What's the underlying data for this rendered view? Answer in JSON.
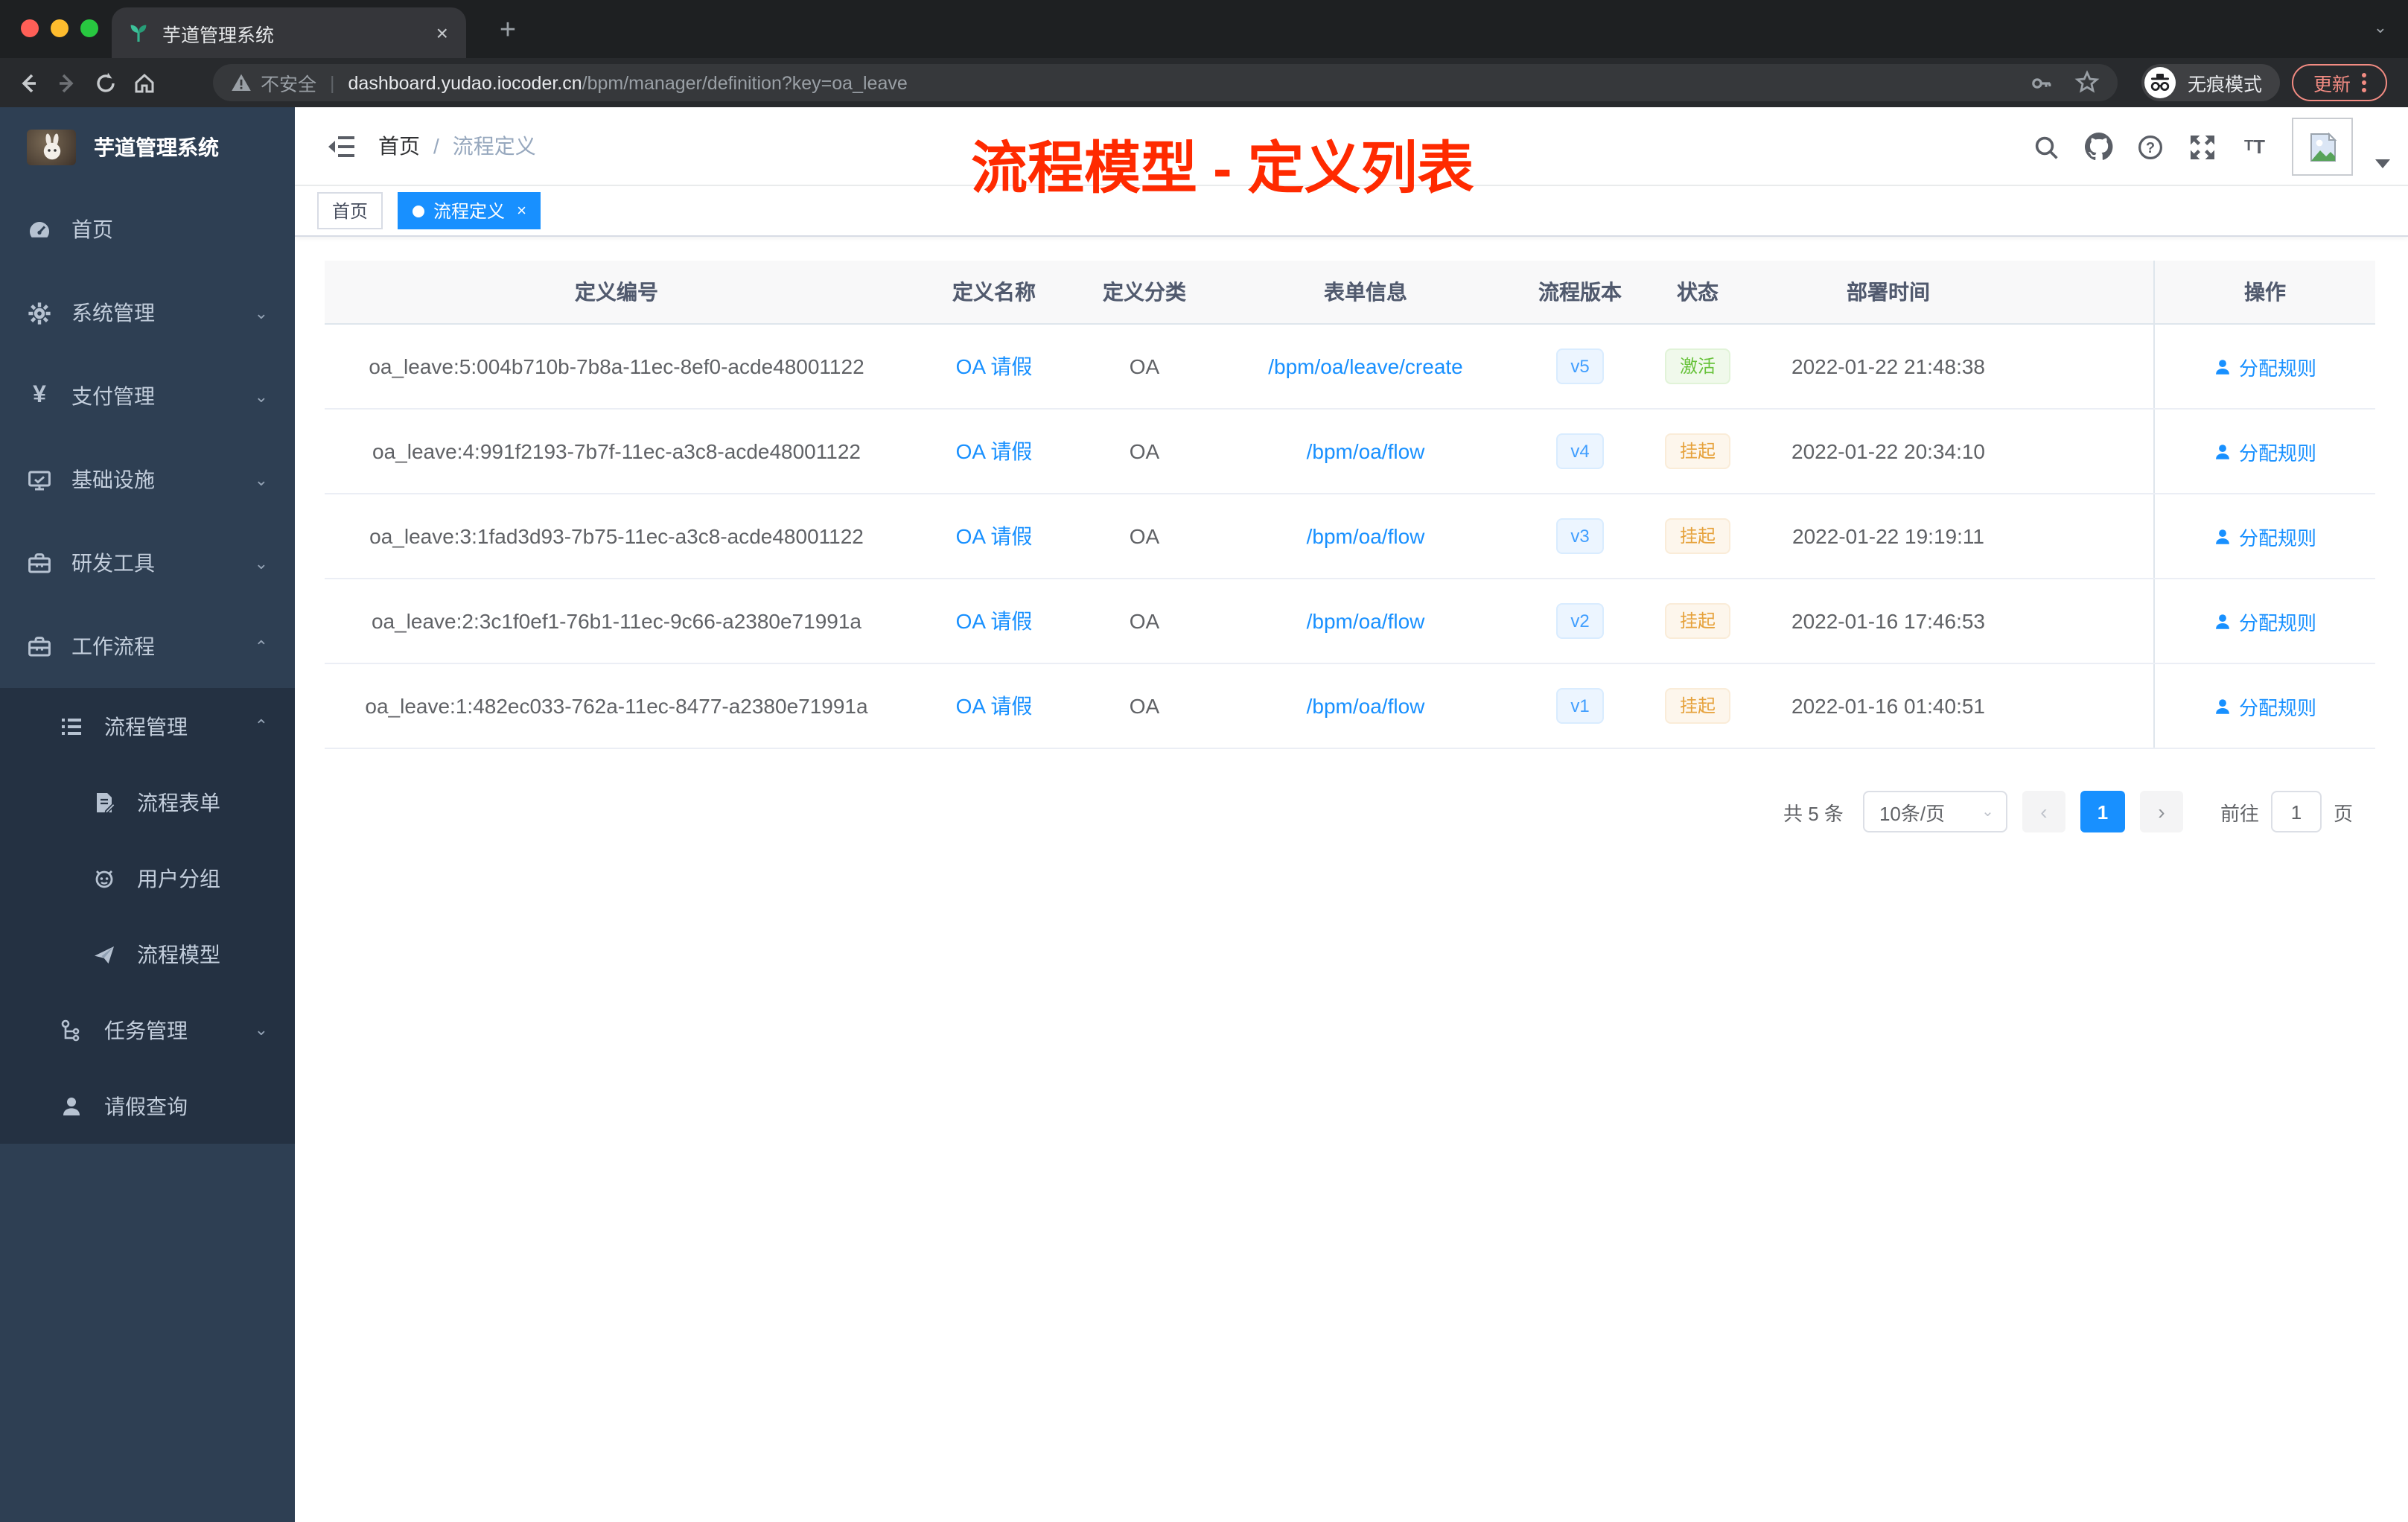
{
  "colors": {
    "accent": "#1890ff",
    "success": "#67c23a",
    "warning": "#e6a23c",
    "sidebar_bg": "#2e3f53",
    "submenu_bg": "#243142",
    "active_tag": "#1890ff",
    "annotation_red": "#ff2a00"
  },
  "icons": {
    "favicon": "seedling-icon",
    "browser": [
      "back-icon",
      "forward-icon",
      "reload-icon",
      "home-icon",
      "warning-icon",
      "key-icon",
      "star-icon",
      "incognito-icon",
      "kebab-icon"
    ],
    "navbar": [
      "search-icon",
      "github-icon",
      "help-icon",
      "fullscreen-icon",
      "font-size-icon",
      "broken-image-icon",
      "caret-down-icon"
    ]
  },
  "browser": {
    "tab_title": "芋道管理系统",
    "close_tab": "×",
    "new_tab": "+",
    "not_secure": "不安全",
    "url_host": "dashboard.yudao.iocoder.cn",
    "url_path": "/bpm/manager/definition?key=oa_leave",
    "incognito_label": "无痕模式",
    "update_label": "更新"
  },
  "annotation": {
    "text": "流程模型 - 定义列表"
  },
  "sidebar": {
    "title": "芋道管理系统",
    "items": [
      {
        "label": "首页",
        "icon": "dashboard-icon"
      },
      {
        "label": "系统管理",
        "icon": "gear-icon",
        "expandable": true
      },
      {
        "label": "支付管理",
        "icon": "yen-icon",
        "expandable": true
      },
      {
        "label": "基础设施",
        "icon": "monitor-icon",
        "expandable": true
      },
      {
        "label": "研发工具",
        "icon": "toolbox-icon",
        "expandable": true
      },
      {
        "label": "工作流程",
        "icon": "briefcase-icon",
        "expandable": true,
        "expanded": true
      }
    ],
    "workflow_children": [
      {
        "label": "流程管理",
        "icon": "list-icon",
        "expandable": true,
        "expanded": true
      },
      {
        "label": "流程表单",
        "icon": "document-edit-icon"
      },
      {
        "label": "用户分组",
        "icon": "robot-icon"
      },
      {
        "label": "流程模型",
        "icon": "paper-plane-icon"
      },
      {
        "label": "任务管理",
        "icon": "tree-icon",
        "expandable": true
      },
      {
        "label": "请假查询",
        "icon": "user-icon"
      }
    ]
  },
  "navbar": {
    "breadcrumb_home": "首页",
    "breadcrumb_sep": "/",
    "breadcrumb_current": "流程定义"
  },
  "tags": {
    "home": "首页",
    "active": "流程定义",
    "active_close": "×"
  },
  "table": {
    "columns": [
      "定义编号",
      "定义名称",
      "定义分类",
      "表单信息",
      "流程版本",
      "状态",
      "部署时间",
      "操作"
    ],
    "rows": [
      {
        "id": "oa_leave:5:004b710b-7b8a-11ec-8ef0-acde48001122",
        "name": "OA 请假",
        "category": "OA",
        "form": "/bpm/oa/leave/create",
        "version": "v5",
        "status": "激活",
        "status_type": "success",
        "deployed_at": "2022-01-22 21:48:38",
        "action": "分配规则"
      },
      {
        "id": "oa_leave:4:991f2193-7b7f-11ec-a3c8-acde48001122",
        "name": "OA 请假",
        "category": "OA",
        "form": "/bpm/oa/flow",
        "version": "v4",
        "status": "挂起",
        "status_type": "warning",
        "deployed_at": "2022-01-22 20:34:10",
        "action": "分配规则"
      },
      {
        "id": "oa_leave:3:1fad3d93-7b75-11ec-a3c8-acde48001122",
        "name": "OA 请假",
        "category": "OA",
        "form": "/bpm/oa/flow",
        "version": "v3",
        "status": "挂起",
        "status_type": "warning",
        "deployed_at": "2022-01-22 19:19:11",
        "action": "分配规则"
      },
      {
        "id": "oa_leave:2:3c1f0ef1-76b1-11ec-9c66-a2380e71991a",
        "name": "OA 请假",
        "category": "OA",
        "form": "/bpm/oa/flow",
        "version": "v2",
        "status": "挂起",
        "status_type": "warning",
        "deployed_at": "2022-01-16 17:46:53",
        "action": "分配规则"
      },
      {
        "id": "oa_leave:1:482ec033-762a-11ec-8477-a2380e71991a",
        "name": "OA 请假",
        "category": "OA",
        "form": "/bpm/oa/flow",
        "version": "v1",
        "status": "挂起",
        "status_type": "warning",
        "deployed_at": "2022-01-16 01:40:51",
        "action": "分配规则"
      }
    ]
  },
  "pagination": {
    "total": "共 5 条",
    "page_size": "10条/页",
    "prev": "‹",
    "page": "1",
    "next": "›",
    "goto_prefix": "前往",
    "goto_value": "1",
    "goto_suffix": "页"
  }
}
